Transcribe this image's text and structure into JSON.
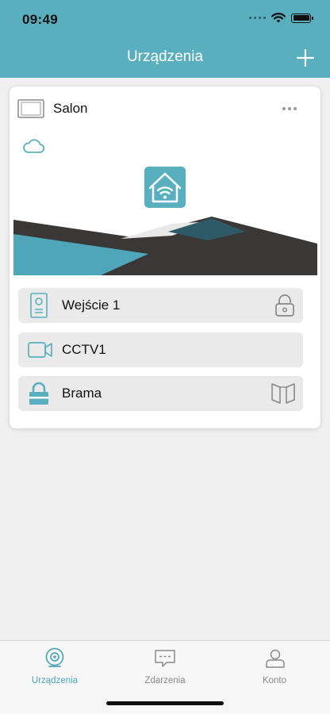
{
  "status_bar": {
    "time": "09:49"
  },
  "nav": {
    "title": "Urządzenia",
    "add_icon": "plus-icon"
  },
  "card": {
    "title": "Salon",
    "icon": "monitor-icon",
    "more_icon": "more-horizontal-icon",
    "cloud_icon": "cloud-icon",
    "devices": [
      {
        "label": "Wejście 1",
        "icon": "door-station-icon",
        "action_icon": "lock-icon"
      },
      {
        "label": "CCTV1",
        "icon": "video-camera-icon"
      },
      {
        "label": "Brama",
        "icon": "padlock-icon",
        "action_icon": "gate-icon"
      }
    ]
  },
  "tabs": [
    {
      "label": "Urządzenia",
      "icon": "camera-device-icon",
      "active": true
    },
    {
      "label": "Zdarzenia",
      "icon": "message-icon",
      "active": false
    },
    {
      "label": "Konto",
      "icon": "user-icon",
      "active": false
    }
  ],
  "colors": {
    "accent": "#5aafbf",
    "accent_dark": "#4fa6b8",
    "row_bg": "#eaeaea",
    "dark": "#3a3737"
  }
}
